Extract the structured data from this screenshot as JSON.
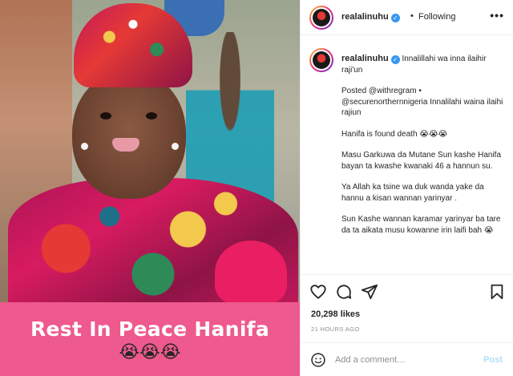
{
  "photo": {
    "caption_title": "Rest In Peace Hanifa",
    "caption_emoji": "😭😭😭"
  },
  "header": {
    "username": "realalinuhu",
    "verified_mark": "✓",
    "separator": "•",
    "follow_label": "Following",
    "more_label": "•••"
  },
  "caption": {
    "username": "realalinuhu",
    "verified_mark": "✓",
    "line1": "Innalillahi wa inna ilaihir raji'un",
    "posted_prefix": "Posted",
    "posted_mention": "@withregram",
    "posted_sep": "•",
    "mention2": "@securenorthernnigeria",
    "mention2_text": "Innalilahi waina ilaihi rajiun",
    "p_found": "Hanifa is found death",
    "p_found_emoji": "😭😭😭",
    "p_masu": "Masu Garkuwa da Mutane Sun kashe Hanifa bayan ta kwashe kwanaki 46 a hannun su.",
    "p_allah": "Ya Allah ka tsine wa duk wanda yake da hannu a kisan wannan yarinyar .",
    "p_sun": "Sun Kashe wannan karamar yarinyar ba tare da ta aikata musu kowanne irin laifi bah",
    "p_sun_emoji": "😭"
  },
  "stats": {
    "likes": "20,298 likes",
    "time": "21 HOURS AGO"
  },
  "comment": {
    "placeholder": "Add a comment…",
    "post_label": "Post"
  },
  "colors": {
    "caption_band": "#ee5a8e",
    "verified": "#3897f0",
    "post_button_disabled": "#b2dffc"
  },
  "icons": [
    "heart-icon",
    "comment-icon",
    "share-icon",
    "bookmark-icon",
    "smiley-icon",
    "more-icon"
  ]
}
